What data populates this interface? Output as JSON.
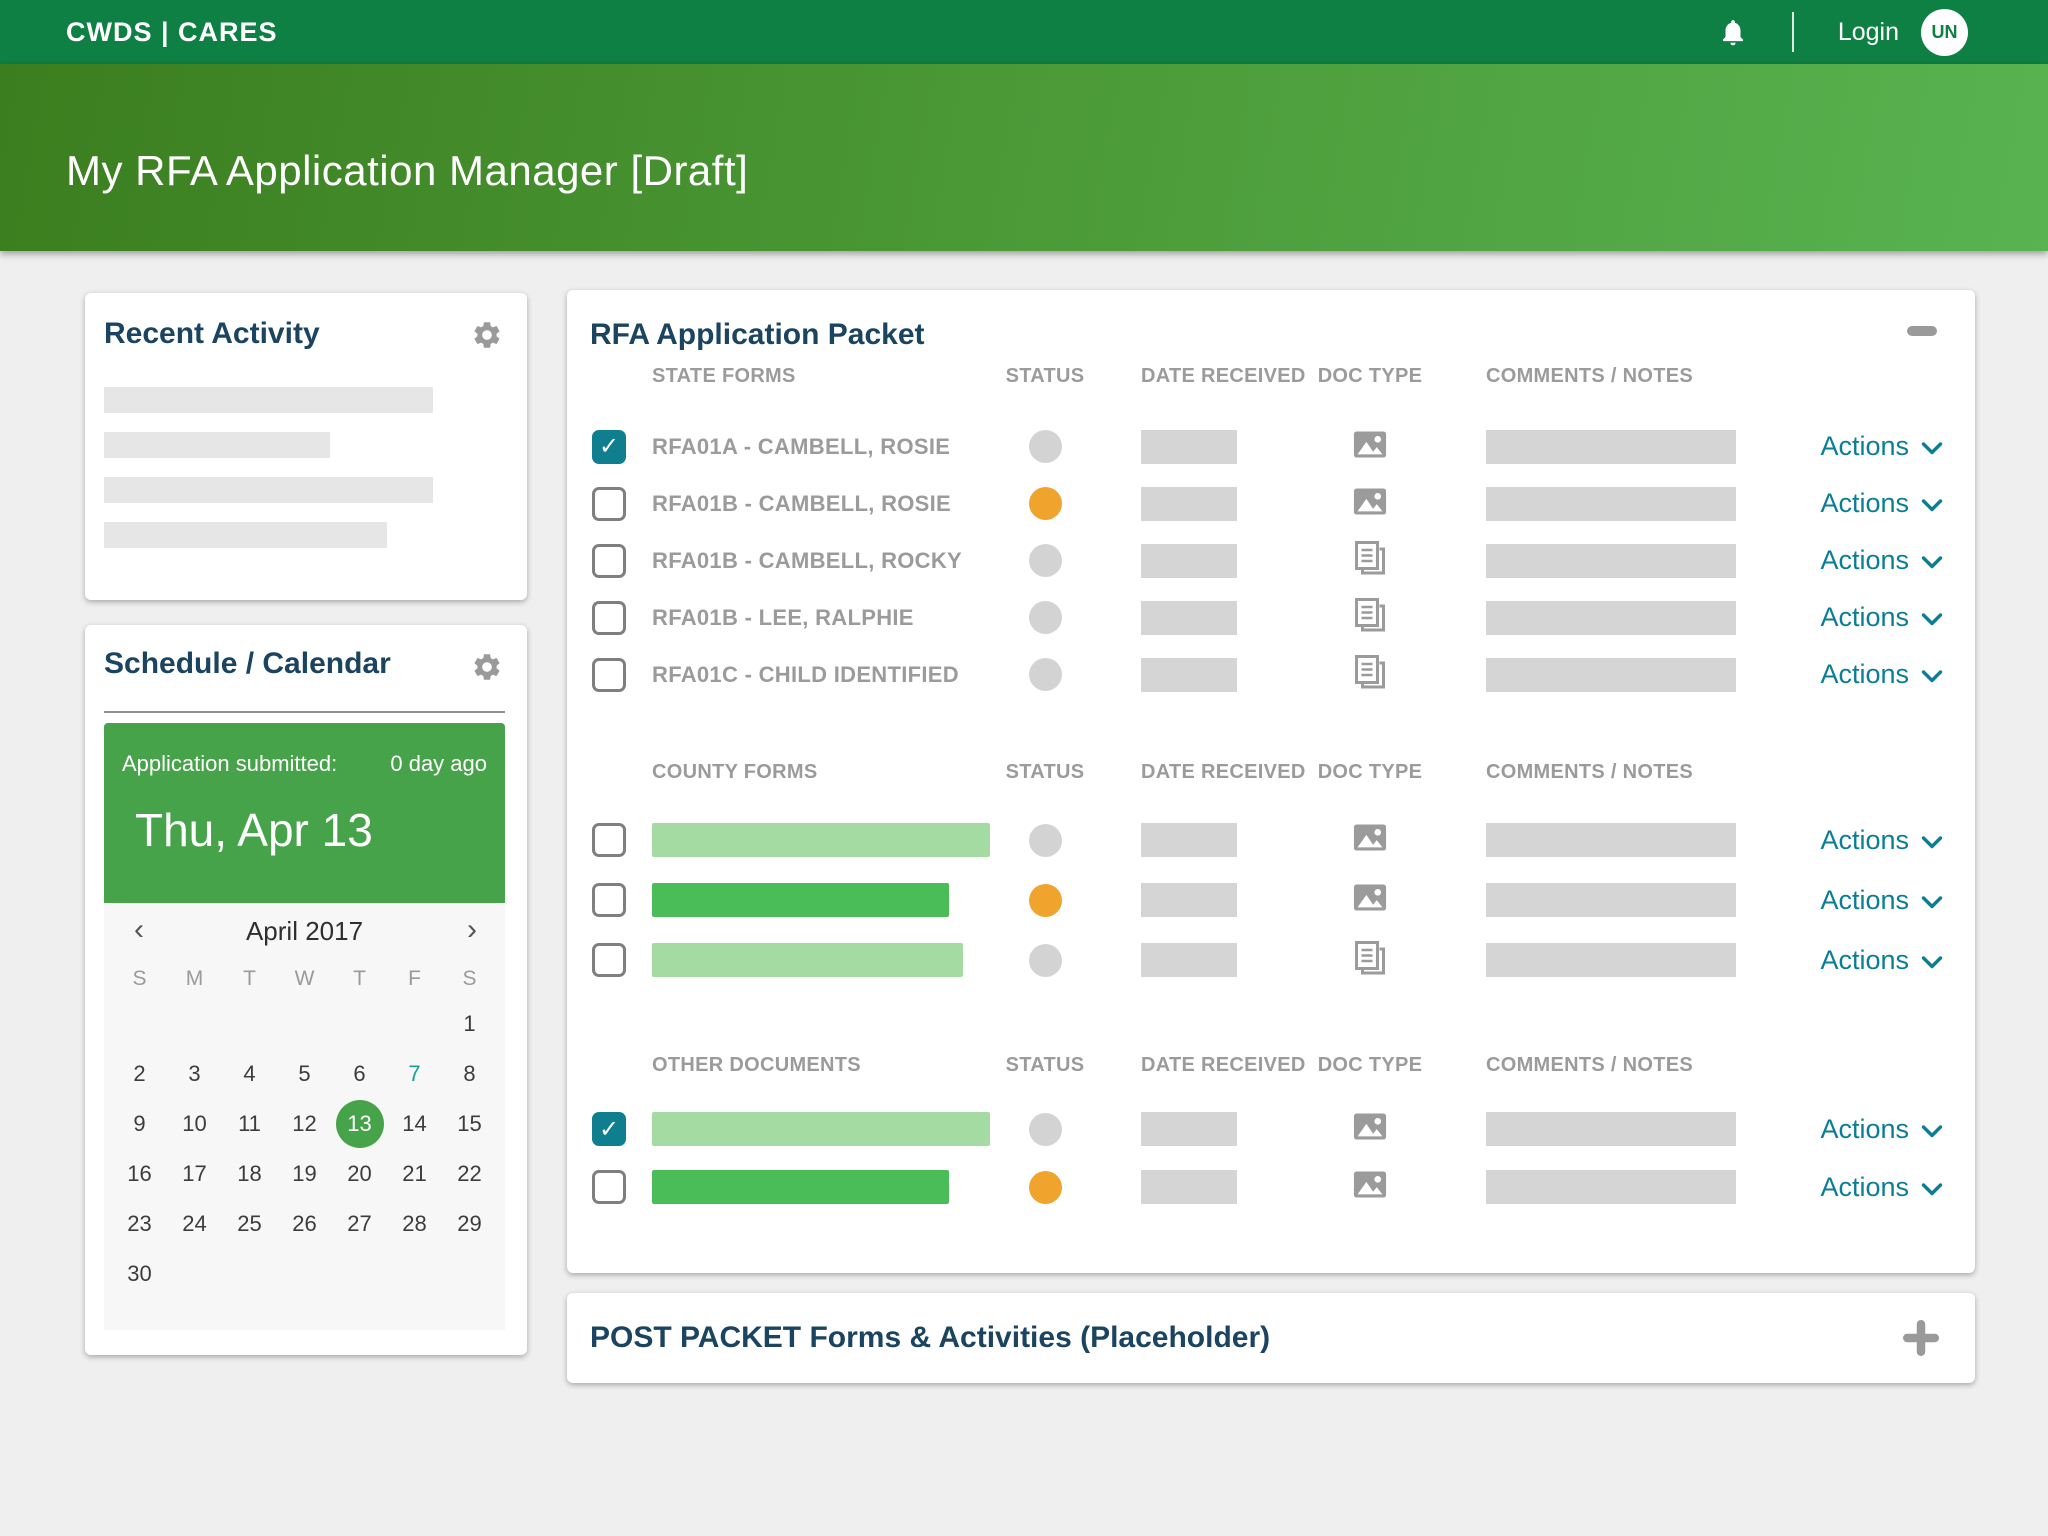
{
  "topbar": {
    "brand": "CWDS | CARES",
    "login_label": "Login",
    "avatar_initials": "UN"
  },
  "page_header": {
    "title": "My RFA Application Manager [Draft]"
  },
  "recent_activity": {
    "title": "Recent Activity",
    "placeholder_bar_widths": [
      329,
      226,
      329,
      283
    ]
  },
  "schedule": {
    "title": "Schedule / Calendar",
    "submitted_label": "Application submitted:",
    "submitted_ago": "0 day ago",
    "submitted_date": "Thu, Apr 13",
    "calendar": {
      "prev_symbol": "‹",
      "next_symbol": "›",
      "month_label": "April 2017",
      "weekdays": [
        "S",
        "M",
        "T",
        "W",
        "T",
        "F",
        "S"
      ],
      "weeks": [
        [
          "",
          "",
          "",
          "",
          "",
          "",
          "1"
        ],
        [
          "2",
          "3",
          "4",
          "5",
          "6",
          "7",
          "8"
        ],
        [
          "9",
          "10",
          "11",
          "12",
          "13",
          "14",
          "15"
        ],
        [
          "16",
          "17",
          "18",
          "19",
          "20",
          "21",
          "22"
        ],
        [
          "23",
          "24",
          "25",
          "26",
          "27",
          "28",
          "29"
        ],
        [
          "30",
          "",
          "",
          "",
          "",
          "",
          ""
        ]
      ],
      "selected_day": "13",
      "accent_day": "7"
    }
  },
  "packet": {
    "title": "RFA Application Packet",
    "actions_label": "Actions",
    "column_headers": [
      "STATUS",
      "DATE RECEIVED",
      "DOC TYPE",
      "COMMENTS / NOTES"
    ],
    "sections": [
      {
        "heading": "STATE FORMS",
        "rows": [
          {
            "label": "RFA01A - CAMBELL, ROSIE",
            "checked": true,
            "status_color": "gray",
            "doc_icon": "image"
          },
          {
            "label": "RFA01B - CAMBELL, ROSIE",
            "checked": false,
            "status_color": "orange",
            "doc_icon": "image"
          },
          {
            "label": "RFA01B - CAMBELL, ROCKY",
            "checked": false,
            "status_color": "gray",
            "doc_icon": "document"
          },
          {
            "label": "RFA01B - LEE, RALPHIE",
            "checked": false,
            "status_color": "gray",
            "doc_icon": "document"
          },
          {
            "label": "RFA01C - CHILD IDENTIFIED",
            "checked": false,
            "status_color": "gray",
            "doc_icon": "document"
          }
        ]
      },
      {
        "heading": "COUNTY FORMS",
        "rows": [
          {
            "placeholder": "light",
            "placeholder_width": 338,
            "checked": false,
            "status_color": "gray",
            "doc_icon": "image"
          },
          {
            "placeholder": "medium",
            "placeholder_width": 297,
            "checked": false,
            "status_color": "orange",
            "doc_icon": "image"
          },
          {
            "placeholder": "light",
            "placeholder_width": 311,
            "checked": false,
            "status_color": "gray",
            "doc_icon": "document"
          }
        ]
      },
      {
        "heading": "OTHER DOCUMENTS",
        "rows": [
          {
            "placeholder": "light",
            "placeholder_width": 338,
            "checked": true,
            "status_color": "gray",
            "doc_icon": "image"
          },
          {
            "placeholder": "medium",
            "placeholder_width": 297,
            "checked": false,
            "status_color": "orange",
            "doc_icon": "image"
          }
        ]
      }
    ]
  },
  "post_packet": {
    "title": "POST PACKET Forms & Activities (Placeholder)"
  },
  "colors": {
    "topbar_green": "#0f8044",
    "header_gradient_start": "#3b7e1f",
    "header_gradient_end": "#58b350",
    "panel_green": "#46a34a",
    "selected_day_green": "#46a34a",
    "bar_light_green": "#a3dba3",
    "bar_medium_green": "#4abc58",
    "checkbox_teal": "#0f7e8e",
    "actions_teal": "#0b7e96",
    "accent_day_teal": "#18a095",
    "status_orange": "#f0a42d",
    "status_gray": "#d3d3d3",
    "heading_navy": "#1a4460",
    "muted_gray": "#9b9b9b"
  }
}
